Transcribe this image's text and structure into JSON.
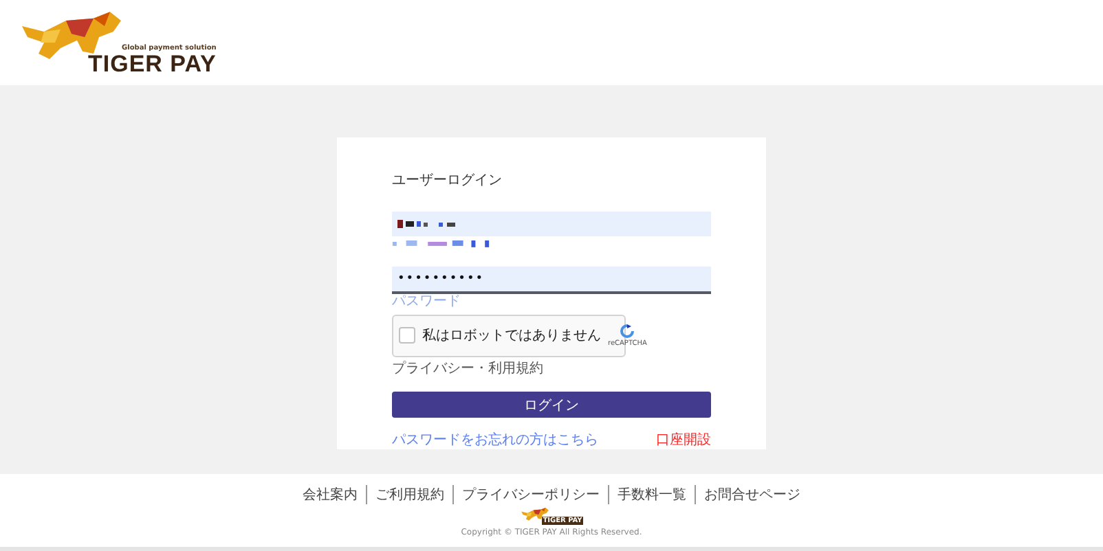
{
  "header": {
    "logo": {
      "tagline": "Global payment solution",
      "name": "TIGER PAY"
    }
  },
  "login": {
    "title": "ユーザーログイン",
    "username": {
      "kind": "redacted"
    },
    "password": {
      "value": "••••••••••",
      "label": "パスワード"
    },
    "captcha": {
      "label": "私はロボットではありません",
      "checked": false,
      "brand": "reCAPTCHA",
      "links": "プライバシー・利用規約"
    },
    "submit": "ログイン",
    "forgot_link": "パスワードをお忘れの方はこちら",
    "open_account_link": "口座開設"
  },
  "footer": {
    "links": [
      "会社案内",
      "ご利用規約",
      "プライバシーポリシー",
      "手数料一覧",
      "お問合せページ"
    ],
    "logo": {
      "name": "TIGER PAY"
    },
    "copyright": "Copyright © TIGER PAY All Rights Reserved."
  }
}
